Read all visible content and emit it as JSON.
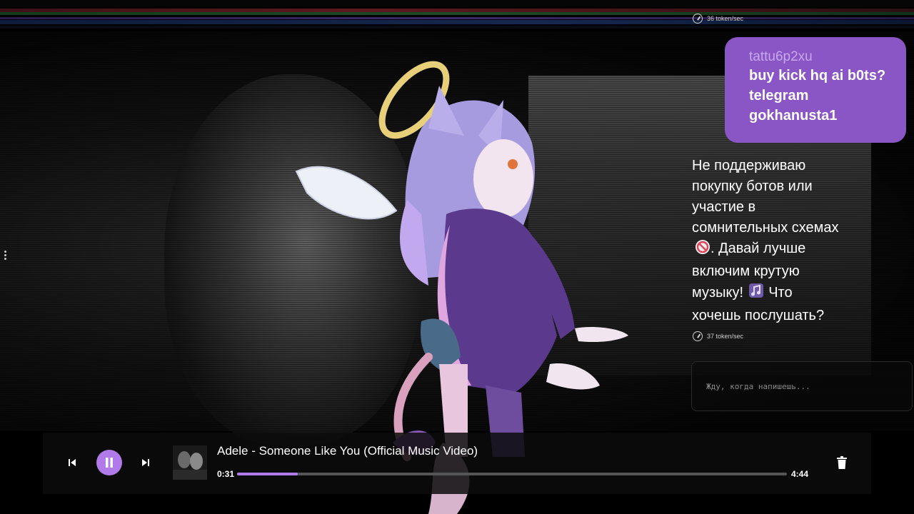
{
  "chat": {
    "top_token_rate": "36 token/sec",
    "user_message": {
      "username": "tattu6p2xu",
      "text_lines": [
        "buy kick hq ai b0ts?",
        "telegram",
        "gokhanusta1"
      ]
    },
    "bot_reply": {
      "lines_before_icon_1": [
        "Не поддерживаю",
        "покупку ботов или",
        "участие в",
        "сомнительных схемах"
      ],
      "line_after_icon_1": ". Давай лучше",
      "line_before_icon_2_a": "включим крутую",
      "line_before_icon_2_b": "музыку!",
      "line_after_icon_2": "Что",
      "last_line": "хочешь послушать?",
      "icon_1": "no-entry-icon",
      "icon_2": "music-note-icon"
    },
    "reply_token_rate": "37 token/sec",
    "input": {
      "placeholder": "Жду, когда напишешь...",
      "value": ""
    }
  },
  "player": {
    "track_title": "Adele - Someone Like You (Official Music Video)",
    "current_time": "0:31",
    "duration": "4:44",
    "progress": 0.11,
    "state": "playing",
    "accent_color": "#b07ae8"
  },
  "colors": {
    "bubble": "#8a55c4",
    "username": "#c9a8ef",
    "accent": "#b07ae8"
  }
}
